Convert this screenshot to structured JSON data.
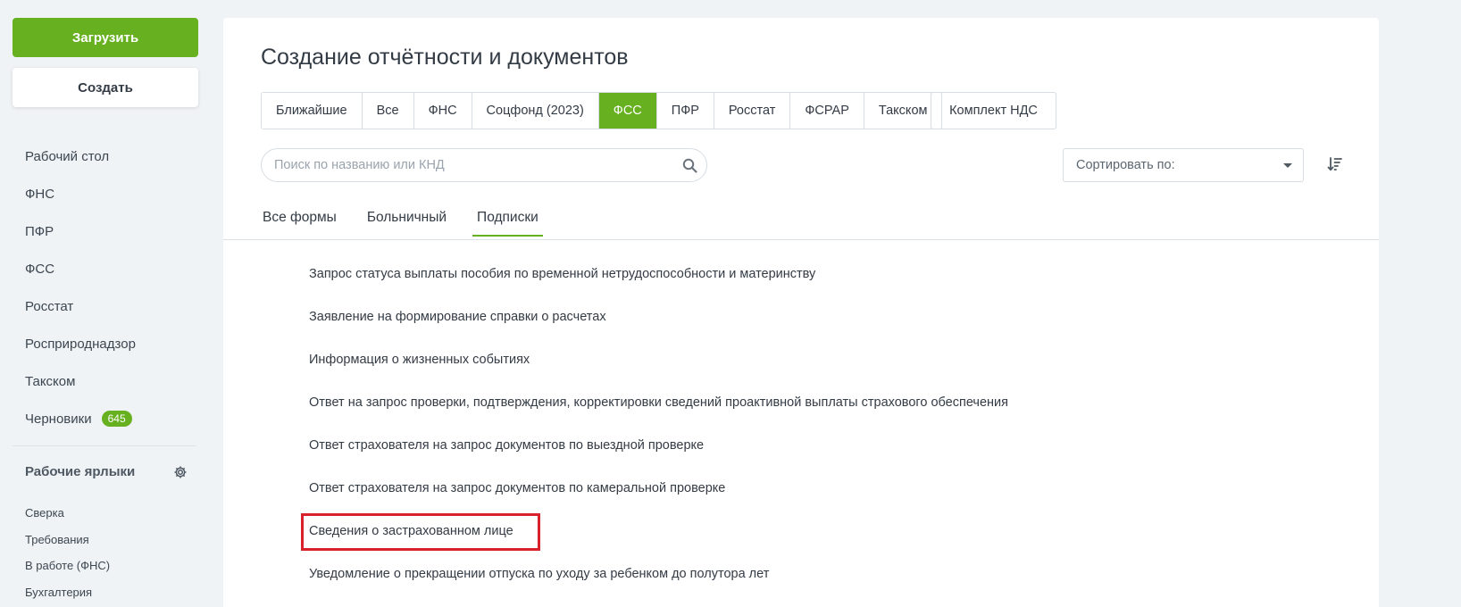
{
  "sidebar": {
    "upload_label": "Загрузить",
    "create_label": "Создать",
    "nav": [
      {
        "label": "Рабочий стол"
      },
      {
        "label": "ФНС"
      },
      {
        "label": "ПФР"
      },
      {
        "label": "ФСС"
      },
      {
        "label": "Росстат"
      },
      {
        "label": "Росприроднадзор"
      },
      {
        "label": "Такском"
      },
      {
        "label": "Черновики",
        "badge": "645"
      }
    ],
    "shortcuts_title": "Рабочие ярлыки",
    "shortcuts": [
      "Сверка",
      "Требования",
      "В работе (ФНС)",
      "Бухгалтерия"
    ]
  },
  "main": {
    "title": "Создание отчётности и документов",
    "tabs": [
      {
        "label": "Ближайшие",
        "active": false
      },
      {
        "label": "Все",
        "active": false
      },
      {
        "label": "ФНС",
        "active": false
      },
      {
        "label": "Соцфонд (2023)",
        "active": false
      },
      {
        "label": "ФСС",
        "active": true
      },
      {
        "label": "ПФР",
        "active": false
      },
      {
        "label": "Росстат",
        "active": false
      },
      {
        "label": "ФСРАР",
        "active": false
      },
      {
        "label": "Такском",
        "active": false
      }
    ],
    "extra_tab": "Комплект НДС",
    "search": {
      "placeholder": "Поиск по названию или КНД",
      "value": ""
    },
    "sort_label": "Сортировать по:",
    "subtabs": [
      {
        "label": "Все формы",
        "active": false
      },
      {
        "label": "Больничный",
        "active": false
      },
      {
        "label": "Подписки",
        "active": true
      }
    ],
    "forms": [
      "Запрос статуса выплаты пособия по временной нетрудоспособности и материнству",
      "Заявление на формирование справки о расчетах",
      "Информация о жизненных событиях",
      "Ответ на запрос проверки, подтверждения, корректировки сведений проактивной выплаты страхового обеспечения",
      "Ответ страхователя на запрос документов по выездной проверке",
      "Ответ страхователя на запрос документов по камеральной проверке",
      "Сведения о застрахованном лице",
      "Уведомление о прекращении отпуска по уходу за ребенком до полутора лет"
    ],
    "highlighted_form_index": 6
  },
  "colors": {
    "accent": "#67b01f",
    "highlight": "#d9212c",
    "background": "#f0f3f6"
  }
}
